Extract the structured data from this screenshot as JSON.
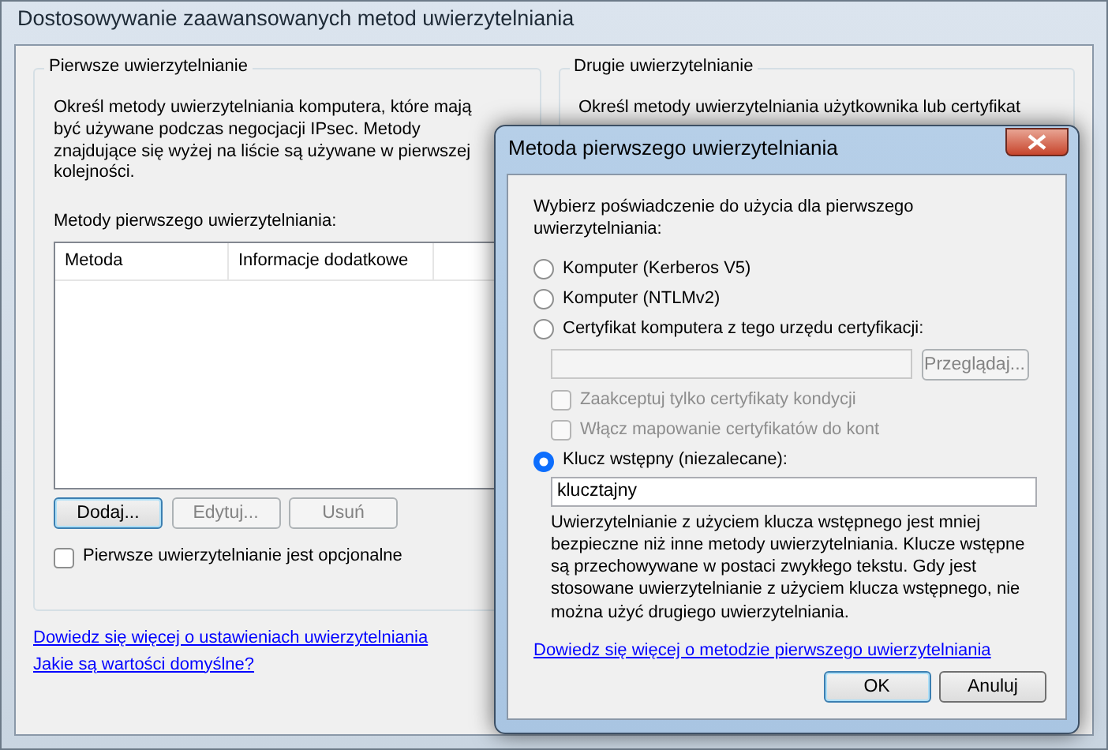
{
  "window": {
    "title": "Dostosowywanie zaawansowanych metod uwierzytelniania"
  },
  "first_auth": {
    "title": "Pierwsze uwierzytelnianie",
    "description": "Określ metody uwierzytelniania komputera, które mają być używane podczas negocjacji IPsec. Metody znajdujące się wyżej na liście są używane w pierwszej kolejności.",
    "list_label": "Metody pierwszego uwierzytelniania:",
    "columns": [
      "Metoda",
      "Informacje dodatkowe"
    ],
    "buttons": [
      {
        "label": "Dodaj...",
        "disabled": false,
        "default": true
      },
      {
        "label": "Edytuj...",
        "disabled": true,
        "default": false
      },
      {
        "label": "Usuń",
        "disabled": true,
        "default": false
      }
    ],
    "optional_checkbox": {
      "label": "Pierwsze uwierzytelnianie jest opcjonalne",
      "checked": false
    }
  },
  "second_auth": {
    "title": "Drugie uwierzytelnianie",
    "description": "Określ metody uwierzytelniania użytkownika lub certyfikat"
  },
  "links": [
    "Dowiedz się więcej o ustawieniach uwierzytelniania",
    "Jakie są wartości domyślne?"
  ],
  "dialog": {
    "title": "Metoda pierwszego uwierzytelniania",
    "prompt": "Wybierz poświadczenie do użycia dla pierwszego uwierzytelniania:",
    "radios": [
      {
        "label": "Komputer (Kerberos V5)",
        "selected": false
      },
      {
        "label": "Komputer (NTLMv2)",
        "selected": false
      },
      {
        "label": "Certyfikat komputera z tego urzędu certyfikacji:",
        "selected": false
      }
    ],
    "browse_button": {
      "label": "Przeglądaj...",
      "disabled": true
    },
    "cert_checkboxes": [
      {
        "label": "Zaakceptuj tylko certyfikaty kondycji",
        "checked": false,
        "disabled": true
      },
      {
        "label": "Włącz mapowanie certyfikatów do kont",
        "checked": false,
        "disabled": true
      }
    ],
    "key_radio": {
      "label": "Klucz wstępny (niezalecane):",
      "selected": true
    },
    "key_field": {
      "value": "klucztajny"
    },
    "note": "Uwierzytelnianie z użyciem klucza wstępnego jest mniej bezpieczne niż inne metody uwierzytelniania. Klucze wstępne są przechowywane w postaci zwykłego tekstu. Gdy jest stosowane uwierzytelnianie z użyciem klucza wstępnego, nie można użyć drugiego uwierzytelniania.",
    "link": "Dowiedz się więcej o metodzie pierwszego uwierzytelniania",
    "buttons": [
      {
        "label": "OK",
        "default": true
      },
      {
        "label": "Anuluj",
        "default": false
      }
    ]
  }
}
